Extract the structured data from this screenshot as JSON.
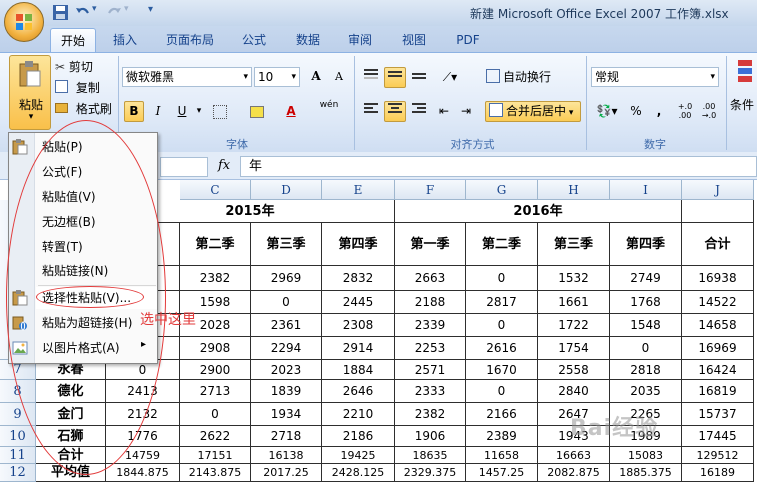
{
  "window": {
    "title": "新建 Microsoft Office Excel 2007 工作簿.xlsx"
  },
  "tabs": [
    "开始",
    "插入",
    "页面布局",
    "公式",
    "数据",
    "审阅",
    "视图",
    "PDF"
  ],
  "ribbon": {
    "paste_label": "粘贴",
    "cut_label": "剪切",
    "copy_label": "复制",
    "format_painter_label": "格式刷",
    "font_name": "微软雅黑",
    "font_size": "10",
    "bold": "B",
    "italic": "I",
    "underline": "U",
    "wrap_text_label": "自动换行",
    "merge_center_label": "合并后居中",
    "number_format": "常规",
    "percent": "%",
    "comma": ",",
    "conditional_label": "条件",
    "group_font": "字体",
    "group_align": "对齐方式",
    "group_number": "数字",
    "font_grow": "A",
    "font_shrink": "A",
    "phonetic": "wén"
  },
  "formula_bar": {
    "fx": "fx",
    "value": "年"
  },
  "columns": [
    "C",
    "D",
    "E",
    "F",
    "G",
    "H",
    "I",
    "J"
  ],
  "rows": [
    "7",
    "8",
    "9",
    "10",
    "11",
    "12"
  ],
  "sheet": {
    "year_2015": "2015年",
    "year_2016": "2016年",
    "headers": [
      "第二季",
      "第三季",
      "第四季",
      "第一季",
      "第二季",
      "第三季",
      "第四季",
      "合计"
    ],
    "header_b_partial": "季",
    "data": [
      {
        "cols": [
          "2382",
          "2969",
          "2832",
          "2663",
          "0",
          "1532",
          "2749",
          "16938"
        ]
      },
      {
        "cols": [
          "1598",
          "0",
          "2445",
          "2188",
          "2817",
          "1661",
          "1768",
          "14522"
        ]
      },
      {
        "cols": [
          "2028",
          "2361",
          "2308",
          "2339",
          "0",
          "1722",
          "1548",
          "14658"
        ]
      },
      {
        "cols": [
          "2908",
          "2294",
          "2914",
          "2253",
          "2616",
          "1754",
          "0",
          "16969"
        ]
      },
      {
        "name": "永春",
        "b": "0",
        "cols": [
          "2900",
          "2023",
          "1884",
          "2571",
          "1670",
          "2558",
          "2818",
          "16424"
        ]
      },
      {
        "name": "德化",
        "b": "2413",
        "cols": [
          "2713",
          "1839",
          "2646",
          "2333",
          "0",
          "2840",
          "2035",
          "16819"
        ]
      },
      {
        "name": "金门",
        "b": "2132",
        "cols": [
          "0",
          "1934",
          "2210",
          "2382",
          "2166",
          "2647",
          "2265",
          "15737"
        ]
      },
      {
        "name": "石狮",
        "b": "1776",
        "cols": [
          "2622",
          "2718",
          "2186",
          "1906",
          "2389",
          "1943",
          "1989",
          "17445"
        ]
      },
      {
        "name": "合计",
        "b": "14759",
        "cols": [
          "17151",
          "16138",
          "19425",
          "18635",
          "11658",
          "16663",
          "15083",
          "129512"
        ]
      },
      {
        "name": "平均值",
        "b": "1844.875",
        "cols": [
          "2143.875",
          "2017.25",
          "2428.125",
          "2329.375",
          "1457.25",
          "2082.875",
          "1885.375",
          "16189"
        ]
      }
    ]
  },
  "menu": {
    "items": [
      "粘贴(P)",
      "公式(F)",
      "粘贴值(V)",
      "无边框(B)",
      "转置(T)",
      "粘贴链接(N)",
      "选择性粘贴(V)...",
      "粘贴为超链接(H)",
      "以图片格式(A)"
    ],
    "submenu_arrow": "▸"
  },
  "annotation": {
    "text": "选中这里"
  },
  "watermark": "Bai经验",
  "colors": {
    "annotation": "#e23a3a",
    "ribbon_blue": "#15428b"
  }
}
